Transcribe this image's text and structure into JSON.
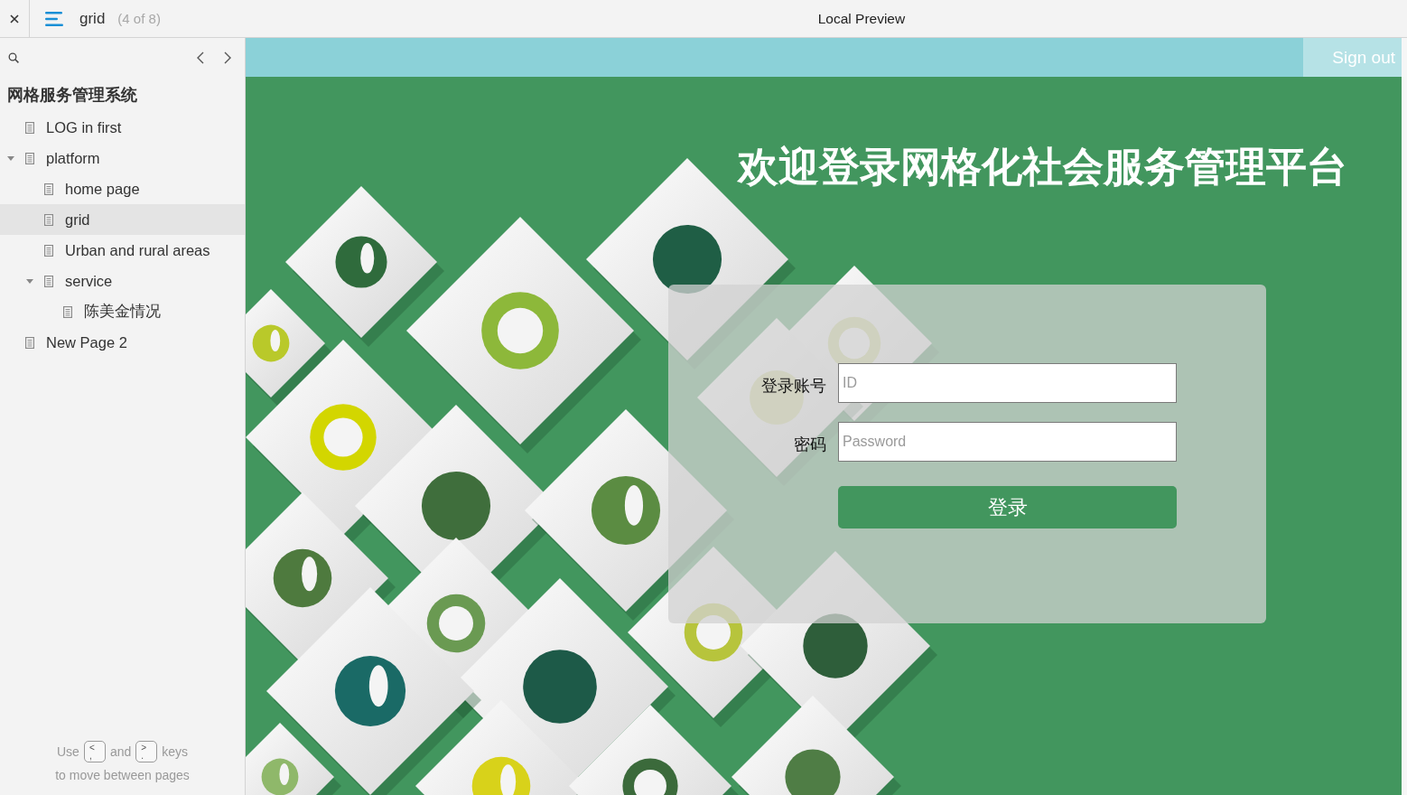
{
  "topbar": {
    "page": "grid",
    "position": "(4 of 8)",
    "title": "Local Preview"
  },
  "sidebar": {
    "project": "网格服务管理系统",
    "pages": [
      {
        "label": "LOG in first",
        "selected": false
      },
      {
        "label": "platform",
        "selected": false,
        "expanded": true,
        "children": [
          {
            "label": "home page",
            "selected": false
          },
          {
            "label": "grid",
            "selected": true
          },
          {
            "label": "Urban and rural areas",
            "selected": false
          },
          {
            "label": "service",
            "selected": false,
            "expanded": true,
            "children": [
              {
                "label": "陈美金情况",
                "selected": false
              }
            ]
          }
        ]
      },
      {
        "label": "New Page 2",
        "selected": false
      }
    ],
    "hint": {
      "before": "Use",
      "prev_key": {
        "upper": "<",
        "lower": ","
      },
      "middle": "and",
      "next_key": {
        "upper": ">",
        "lower": "."
      },
      "after": "keys",
      "line_2": "to move between pages"
    }
  },
  "banner": {
    "sign_out": "Sign out"
  },
  "login": {
    "heading": "欢迎登录网格化社会服务管理平台",
    "fields": [
      {
        "label": "登录账号",
        "placeholder": "ID"
      },
      {
        "label": "密码",
        "placeholder": "Password"
      }
    ],
    "submit": "登录"
  }
}
